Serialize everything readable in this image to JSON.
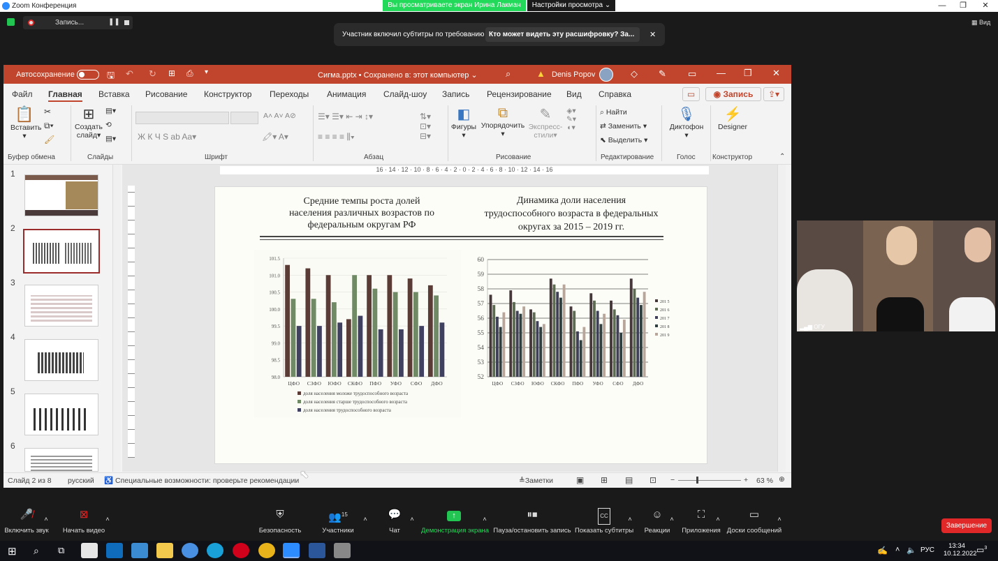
{
  "zoom": {
    "window_title": "Zoom Конференция",
    "share_banner": "Вы просматриваете экран Ирина Лакман",
    "view_options": "Настройки просмотра ⌄",
    "recording_label": "Запись...",
    "view_label": "Вид",
    "subtitle_notice": "Участник включил субтитры по требованию",
    "subtitle_link": "Кто может видеть эту расшифровку? За...",
    "participant_name": "ОГУ",
    "toolbar": [
      {
        "id": "audio",
        "label": "Включить звук",
        "icon": "mic-muted-icon"
      },
      {
        "id": "video",
        "label": "Начать видео",
        "icon": "camera-off-icon"
      },
      {
        "id": "security",
        "label": "Безопасность",
        "icon": "shield-icon"
      },
      {
        "id": "participants",
        "label": "Участники",
        "icon": "people-icon",
        "count": "15"
      },
      {
        "id": "chat",
        "label": "Чат",
        "icon": "chat-icon"
      },
      {
        "id": "share",
        "label": "Демонстрация экрана",
        "icon": "share-screen-icon"
      },
      {
        "id": "record",
        "label": "Пауза/остановить запись",
        "icon": "pause-stop-icon"
      },
      {
        "id": "cc",
        "label": "Показать субтитры",
        "icon": "cc-icon"
      },
      {
        "id": "reactions",
        "label": "Реакции",
        "icon": "smiley-icon"
      },
      {
        "id": "apps",
        "label": "Приложения",
        "icon": "apps-icon"
      },
      {
        "id": "whiteboards",
        "label": "Доски сообщений",
        "icon": "whiteboard-icon"
      }
    ],
    "end_label": "Завершение"
  },
  "ppt": {
    "autosave": "Автосохранение",
    "filename": "Сигма.pptx  •  Сохранено в: этот компьютер ⌄",
    "user": "Denis Popov",
    "tabs": [
      "Файл",
      "Главная",
      "Вставка",
      "Рисование",
      "Конструктор",
      "Переходы",
      "Анимация",
      "Слайд-шоу",
      "Запись",
      "Рецензирование",
      "Вид",
      "Справка"
    ],
    "record_btn": "Запись",
    "ribbon": {
      "paste": "Вставить",
      "new_slide": "Создать",
      "new_slide2": "слайд",
      "shapes": "Фигуры",
      "arrange": "Упорядочить",
      "quick_styles": "Экспресс-",
      "quick_styles2": "стили",
      "find": "Найти",
      "replace": "Заменить",
      "select": "Выделить",
      "dictate": "Диктофон",
      "designer": "Designer",
      "groups": [
        "Буфер обмена",
        "Слайды",
        "Шрифт",
        "Абзац",
        "Рисование",
        "Редактирование",
        "Голос",
        "Конструктор"
      ]
    },
    "ruler": "16 · 14 · 12 · 10 · 8 · 6 · 4 · 2 · 0 · 2 · 4 · 6 · 8 · 10 · 12 · 14 · 16",
    "status": {
      "slide": "Слайд 2 из 8",
      "lang": "русский",
      "access": "Специальные возможности: проверьте рекомендации",
      "notes": "Заметки",
      "zoom": "63 %"
    },
    "thumb_numbers": [
      "1",
      "2",
      "3",
      "4",
      "5",
      "6"
    ]
  },
  "slide": {
    "title_left": [
      "Средние темпы роста долей",
      "населения различных возрастов по",
      "федеральным округам РФ"
    ],
    "title_right": [
      "Динамика доли населения",
      "трудоспособного возраста в федеральных",
      "округах за 2015 – 2019 гг."
    ]
  },
  "chart_data": [
    {
      "type": "bar",
      "categories": [
        "ЦФО",
        "СЗФО",
        "ЮФО",
        "СКФО",
        "ПФО",
        "УФО",
        "СФО",
        "ДФО"
      ],
      "ylim": [
        98.0,
        101.5
      ],
      "yticks": [
        "101.5",
        "101.0",
        "100.5",
        "100.0",
        "99.5",
        "99.0",
        "98.5",
        "98.0"
      ],
      "series": [
        {
          "name": "доля населения моложе трудоспособного возраста",
          "color": "#5a3b35",
          "values": [
            101.3,
            101.2,
            101.0,
            99.7,
            101.0,
            101.0,
            100.9,
            100.7
          ]
        },
        {
          "name": "доля населения старше трудоспособного возраста",
          "color": "#6f8a65",
          "values": [
            100.3,
            100.3,
            100.2,
            101.0,
            100.6,
            100.5,
            100.5,
            100.4
          ]
        },
        {
          "name": "доля населения трудоспособного возраста",
          "color": "#404060",
          "values": [
            99.5,
            99.5,
            99.6,
            99.8,
            99.4,
            99.4,
            99.5,
            99.6
          ]
        }
      ]
    },
    {
      "type": "bar",
      "categories": [
        "ЦФО",
        "СЗФО",
        "ЮФО",
        "СКФО",
        "ПФО",
        "УФО",
        "СФО",
        "ДФО"
      ],
      "ylim": [
        52,
        60
      ],
      "yticks": [
        "60",
        "59",
        "58",
        "57",
        "56",
        "55",
        "54",
        "53",
        "52"
      ],
      "series": [
        {
          "name": "2015",
          "color": "#45373a",
          "values": [
            57.6,
            57.9,
            56.6,
            58.7,
            56.8,
            57.7,
            57.2,
            58.7
          ]
        },
        {
          "name": "2016",
          "color": "#5c6b52",
          "values": [
            56.9,
            57.1,
            56.4,
            58.3,
            56.5,
            57.2,
            56.6,
            58.0
          ]
        },
        {
          "name": "2017",
          "color": "#3f3f57",
          "values": [
            56.1,
            56.5,
            55.8,
            57.8,
            55.1,
            56.5,
            56.2,
            57.4
          ]
        },
        {
          "name": "2018",
          "color": "#2f3f3f",
          "values": [
            55.4,
            56.3,
            55.4,
            57.4,
            54.5,
            55.6,
            55.0,
            56.9
          ]
        },
        {
          "name": "2019",
          "color": "#b8a69a",
          "values": [
            56.4,
            56.8,
            55.6,
            58.3,
            55.4,
            56.3,
            55.9,
            57.8
          ]
        }
      ],
      "legend": [
        "201 5",
        "201 6",
        "201 7",
        "201 8",
        "201 9"
      ]
    }
  ],
  "system": {
    "time": "13:34",
    "date": "10.12.2022",
    "lang": "РУС",
    "notif_count": "3"
  }
}
